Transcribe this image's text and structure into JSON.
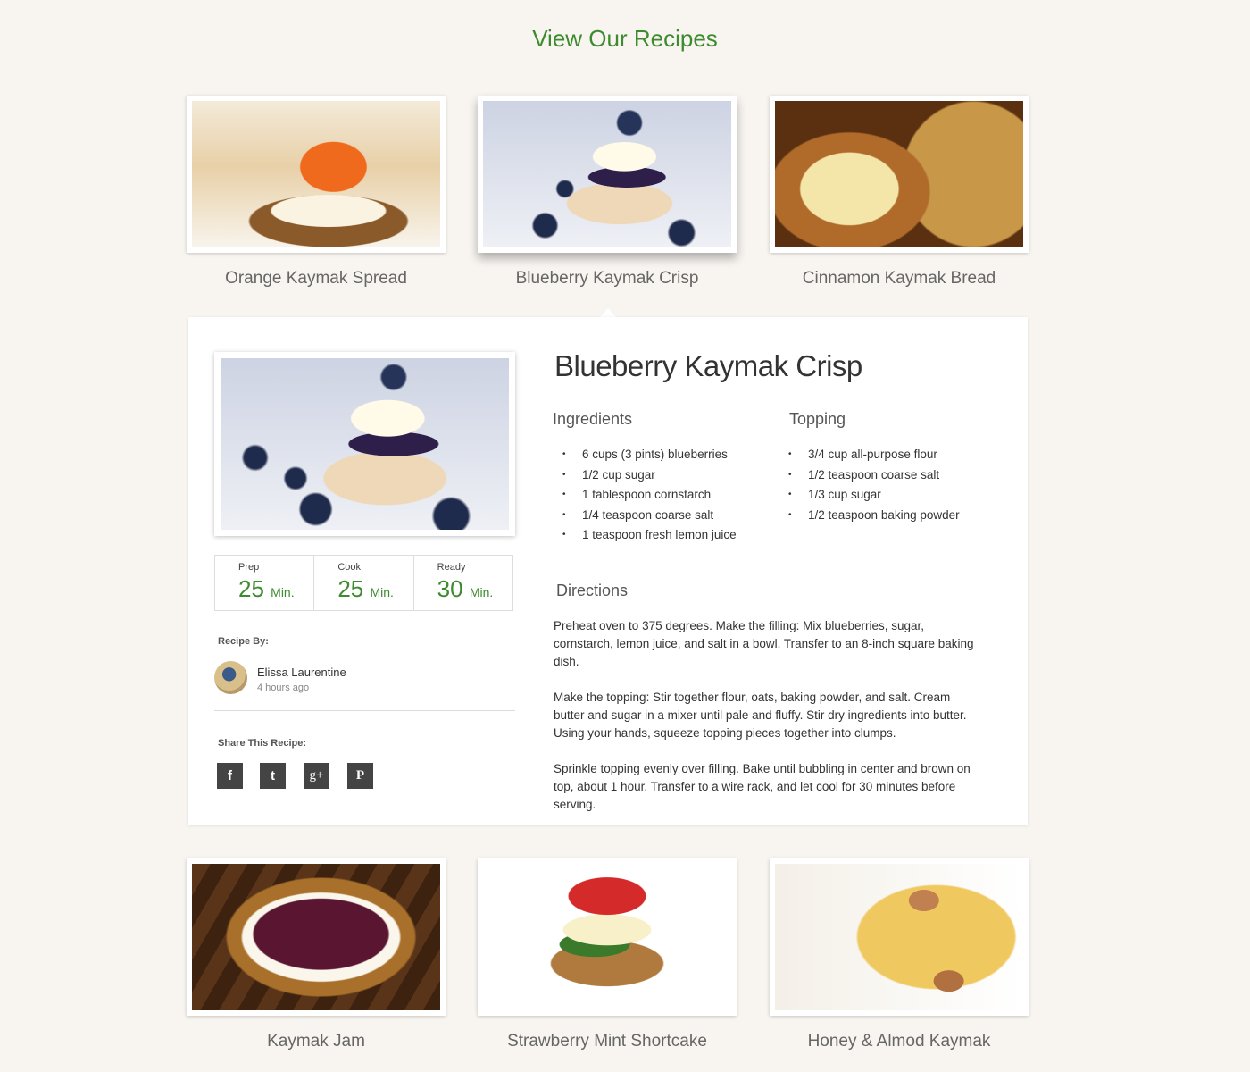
{
  "header": {
    "title": "View Our Recipes"
  },
  "colors": {
    "accent": "#3d8b2f",
    "background": "#f8f4f0"
  },
  "recipes_top": [
    {
      "name": "Orange Kaymak Spread"
    },
    {
      "name": "Blueberry Kaymak Crisp",
      "active": true
    },
    {
      "name": "Cinnamon Kaymak Bread"
    }
  ],
  "recipes_bottom": [
    {
      "name": "Kaymak Jam"
    },
    {
      "name": "Strawberry Mint Shortcake"
    },
    {
      "name": "Honey & Almod Kaymak"
    }
  ],
  "detail": {
    "title": "Blueberry Kaymak Crisp",
    "stats": [
      {
        "label": "Prep",
        "value": "25",
        "unit": "Min."
      },
      {
        "label": "Cook",
        "value": "25",
        "unit": "Min."
      },
      {
        "label": "Ready",
        "value": "30",
        "unit": "Min."
      }
    ],
    "recipe_by_label": "Recipe By:",
    "author": {
      "name": "Elissa Laurentine",
      "time": "4 hours ago"
    },
    "share_label": "Share This Recipe:",
    "share_icons": [
      "facebook-icon",
      "twitter-icon",
      "google-plus-icon",
      "pinterest-icon"
    ],
    "ingredients_title": "Ingredients",
    "ingredients": [
      "6 cups (3 pints) blueberries",
      "1/2 cup sugar",
      "1 tablespoon cornstarch",
      "1/4 teaspoon coarse salt",
      "1 teaspoon fresh lemon juice"
    ],
    "topping_title": "Topping",
    "topping": [
      "3/4 cup all-purpose flour",
      "1/2 teaspoon coarse salt",
      "1/3 cup sugar",
      "1/2 teaspoon baking powder"
    ],
    "directions_title": "Directions",
    "directions": [
      "Preheat oven to 375 degrees. Make the filling: Mix blueberries, sugar, cornstarch, lemon juice, and salt in a bowl. Transfer to an 8-inch square baking dish.",
      "Make the topping: Stir together flour, oats, baking powder, and salt. Cream butter and sugar in a mixer until pale and fluffy. Stir dry ingredients into butter. Using your hands, squeeze topping pieces together into clumps.",
      "Sprinkle topping evenly over filling. Bake until bubbling in center and brown on top, about 1 hour. Transfer to a wire rack, and let cool for 30 minutes before serving."
    ]
  }
}
